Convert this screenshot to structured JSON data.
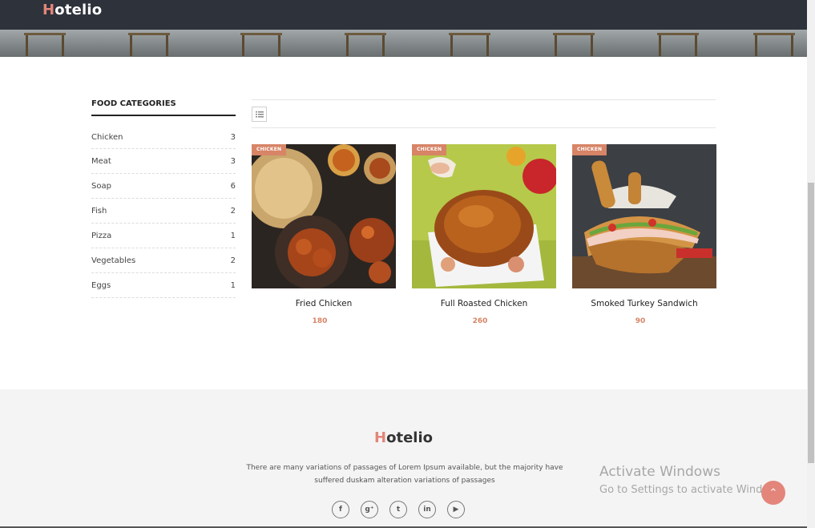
{
  "header": {
    "logo_first": "H",
    "logo_rest": "otelio"
  },
  "sidebar": {
    "title": "FOOD CATEGORIES",
    "items": [
      {
        "label": "Chicken",
        "count": "3"
      },
      {
        "label": "Meat",
        "count": "3"
      },
      {
        "label": "Soap",
        "count": "6"
      },
      {
        "label": "Fish",
        "count": "2"
      },
      {
        "label": "Pizza",
        "count": "1"
      },
      {
        "label": "Vegetables",
        "count": "2"
      },
      {
        "label": "Eggs",
        "count": "1"
      }
    ]
  },
  "toolbar": {
    "list_icon": "list-view-icon"
  },
  "products": [
    {
      "tag": "CHICKEN",
      "title": "Fried Chicken",
      "price": "180"
    },
    {
      "tag": "CHICKEN",
      "title": "Full Roasted Chicken",
      "price": "260"
    },
    {
      "tag": "CHICKEN",
      "title": "Smoked Turkey Sandwich",
      "price": "90"
    }
  ],
  "footer": {
    "logo_first": "H",
    "logo_rest": "otelio",
    "text": "There are many variations of passages of Lorem Ipsum available, but the majority have suffered duskam alteration variations of passages",
    "socials": [
      "facebook-icon",
      "google-plus-icon",
      "tumblr-icon",
      "linkedin-icon",
      "youtube-icon"
    ]
  },
  "watermark": {
    "line1": "Activate Windows",
    "line2": "Go to Settings to activate Windows."
  },
  "colors": {
    "accent": "#e3857a",
    "tag": "#d78467",
    "header_bg": "#2e323a",
    "footer_bg": "#f4f4f4"
  }
}
